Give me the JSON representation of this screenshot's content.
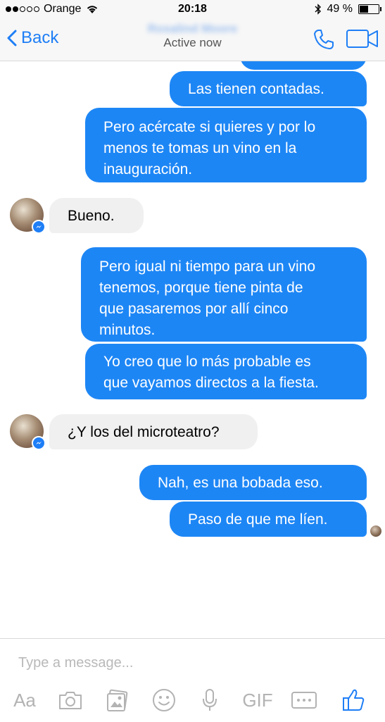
{
  "status_bar": {
    "carrier": "Orange",
    "time": "20:18",
    "battery_label": "49 %",
    "battery_level": 0.49
  },
  "nav": {
    "back_label": "Back",
    "contact_name": "Rosalind Moore",
    "status": "Active now"
  },
  "messages": [
    {
      "from": "me",
      "text": "Las tienen contadas."
    },
    {
      "from": "me",
      "text": "Pero acércate si quieres y por lo\nmenos te tomas un vino en la\ninauguración."
    },
    {
      "from": "contact",
      "text": "Bueno."
    },
    {
      "from": "me",
      "text": "Pero igual ni tiempo para un vino\ntenemos, porque tiene pinta de\nque pasaremos por allí cinco\nminutos."
    },
    {
      "from": "me",
      "text": "Yo creo que lo más probable es\nque vayamos directos a la fiesta."
    },
    {
      "from": "contact",
      "text": "¿Y los del microteatro?"
    },
    {
      "from": "me",
      "text": "Nah, es una bobada eso."
    },
    {
      "from": "me",
      "text": "Paso de que me líen."
    }
  ],
  "composer": {
    "placeholder": "Type a message...",
    "text_tool": "Aa",
    "gif_label": "GIF"
  },
  "colors": {
    "accent": "#1e7ef6",
    "outgoing_bubble": "#1d86f5",
    "incoming_bubble": "#f0f0f0",
    "toolbar_icon": "#b3b3b3"
  },
  "icons": [
    "signal-dots-icon",
    "wifi-icon",
    "bluetooth-icon",
    "battery-icon",
    "back-chevron-icon",
    "phone-icon",
    "video-camera-icon",
    "messenger-badge-icon",
    "camera-icon",
    "photos-icon",
    "emoji-icon",
    "microphone-icon",
    "more-icon",
    "like-icon"
  ]
}
